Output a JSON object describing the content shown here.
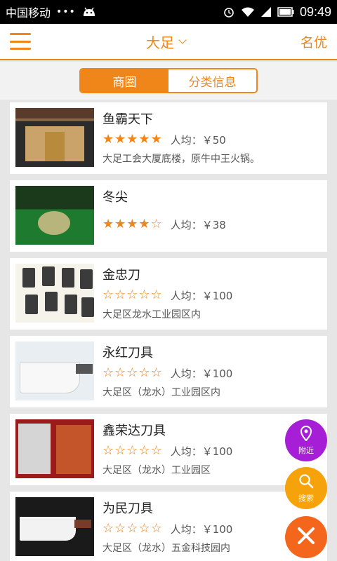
{
  "status_bar": {
    "carrier": "中国移动",
    "dots": "•••",
    "time": "09:49"
  },
  "header": {
    "city": "大足",
    "brand": "名优"
  },
  "tabs": [
    {
      "label": "商圈"
    },
    {
      "label": "分类信息"
    }
  ],
  "items": [
    {
      "name": "鱼霸天下",
      "rating": 5,
      "avg": "人均：￥50",
      "address": "大足工会大厦底楼，原牛中王火锅。"
    },
    {
      "name": "冬尖",
      "rating": 4,
      "avg": "人均：￥38",
      "address": ""
    },
    {
      "name": "金忠刀",
      "rating": 0,
      "avg": "人均：￥100",
      "address": "大足区龙水工业园区内"
    },
    {
      "name": "永红刀具",
      "rating": 0,
      "avg": "人均：￥100",
      "address": "大足区（龙水）工业园区内"
    },
    {
      "name": "鑫荣达刀具",
      "rating": 0,
      "avg": "人均：￥100",
      "address": "大足区（龙水）工业园区"
    },
    {
      "name": "为民刀具",
      "rating": 0,
      "avg": "人均：￥100",
      "address": "大足区（龙水）五金科技园内"
    }
  ],
  "fabs": {
    "nearby": "附近",
    "search": "搜索"
  },
  "colors": {
    "accent": "#f08519",
    "nearby": "#a61fd6",
    "search": "#f5a20b",
    "close": "#f5661d"
  },
  "icons": {
    "menu": "hamburger-icon",
    "city_dropdown": "chevron-down-icon",
    "nearby": "location-pin-icon",
    "search": "search-icon",
    "close": "close-icon",
    "star_filled": "star-filled-icon",
    "star_empty": "star-outline-icon"
  }
}
